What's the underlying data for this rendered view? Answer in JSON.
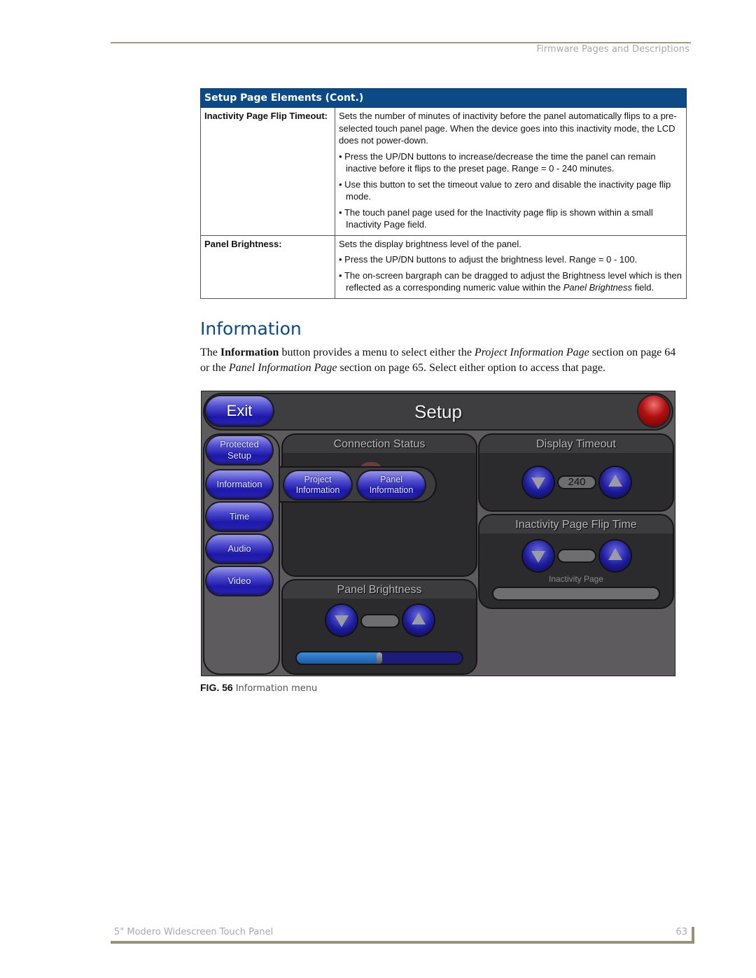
{
  "header": {
    "section": "Firmware Pages and Descriptions"
  },
  "table": {
    "title": "Setup Page Elements (Cont.)",
    "rows": [
      {
        "term": "Inactivity Page Flip Timeout:",
        "description": "Sets the number of minutes of inactivity before the panel automatically flips to a pre-selected touch panel page. When the device goes into this inactivity mode, the LCD does not power-down.",
        "bullets": [
          "Press the UP/DN buttons to increase/decrease the time the panel can remain inactive before it flips to the preset page. Range = 0 - 240 minutes.",
          "Use this button to set the timeout value to zero and disable the inactivity page flip mode.",
          "The touch panel page used for the Inactivity page flip is shown within a small Inactivity Page field."
        ]
      },
      {
        "term": "Panel Brightness:",
        "description": "Sets the display brightness level of the panel.",
        "bullets": [
          "Press the UP/DN buttons to adjust the brightness level. Range = 0 - 100.",
          "The on-screen bargraph can be dragged to adjust the Brightness level which is then reflected as a corresponding numeric value within the ",
          "Panel Brightness",
          " field."
        ]
      }
    ]
  },
  "section": {
    "title": "Information",
    "intro_parts": [
      "The ",
      "Information",
      " button provides a menu to select either the ",
      "Project Information Page",
      " section on page 64 or the ",
      "Panel Information Page",
      " section on page 65. Select either option to access that page."
    ]
  },
  "panel": {
    "title": "Setup",
    "exit_label": "Exit",
    "sidebar": [
      "Protected Setup",
      "Information",
      "Time",
      "Audio",
      "Video"
    ],
    "flyout": [
      "Project Information",
      "Panel Information"
    ],
    "sections": {
      "connection_status": "Connection Status",
      "display_timeout": "Display Timeout",
      "display_timeout_value": "240",
      "inactivity_flip": "Inactivity Page Flip Time",
      "inactivity_flip_value": "",
      "inactivity_page_label": "Inactivity Page",
      "panel_brightness": "Panel Brightness",
      "panel_brightness_value": ""
    },
    "brightness_level_fraction": 0.5,
    "colors": {
      "button_blue": "#2a25b8",
      "status_red": "#b01010",
      "panel_gray": "#5d5b5e"
    }
  },
  "figure": {
    "label": "FIG. 56",
    "caption": "Information menu"
  },
  "footer": {
    "product": "5\" Modero Widescreen Touch Panel",
    "page": "63"
  }
}
